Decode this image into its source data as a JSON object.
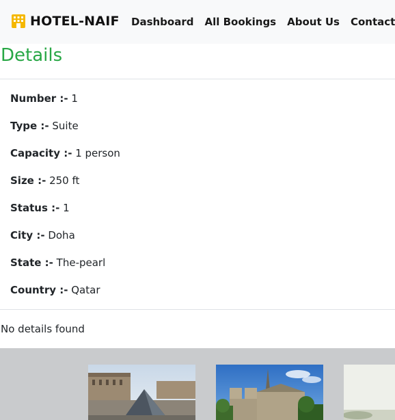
{
  "navbar": {
    "brand": "HOTEL-NAIF",
    "brand_icon": "hotel-building-icon",
    "links": [
      "Dashboard",
      "All Bookings",
      "About Us",
      "Contact"
    ]
  },
  "page": {
    "title": "Details",
    "details": [
      {
        "label": "Number :-",
        "value": "1"
      },
      {
        "label": "Type :-",
        "value": "Suite"
      },
      {
        "label": "Capacity :-",
        "value": "1 person"
      },
      {
        "label": "Size :-",
        "value": "250 ft"
      },
      {
        "label": "Status :-",
        "value": "1"
      },
      {
        "label": "City :-",
        "value": "Doha"
      },
      {
        "label": "State :-",
        "value": "The-pearl"
      },
      {
        "label": "Country :-",
        "value": "Qatar"
      }
    ],
    "empty_message": "No details found"
  },
  "gallery": {
    "images": [
      "louvre-pyramid-photo",
      "notre-dame-cathedral-photo",
      "landmark-photo"
    ]
  },
  "colors": {
    "title_green": "#28a745",
    "navbar_bg": "#f8f9fa",
    "footer_bg": "#c9cbcd",
    "brand_icon": "#f5b800"
  }
}
